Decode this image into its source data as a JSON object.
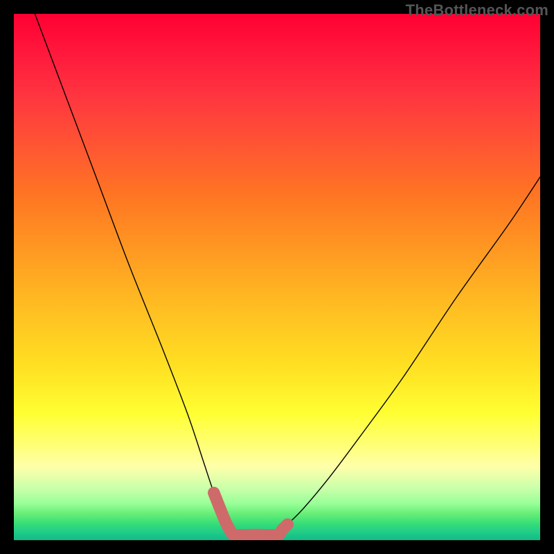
{
  "watermark": "TheBottleneck.com",
  "chart_data": {
    "type": "line",
    "title": "",
    "xlabel": "",
    "ylabel": "",
    "xlim": [
      0,
      100
    ],
    "ylim": [
      0,
      100
    ],
    "grid": false,
    "background_gradient": {
      "top_color": "#ff0033",
      "mid_color": "#ffff33",
      "bottom_color": "#22cc88",
      "description": "vertical red→yellow→green gradient; bottom ~3% shows striped green bands"
    },
    "series": [
      {
        "name": "bottleneck-curve",
        "description": "black V-shaped curve; steep descent on left, shallower ascent on right",
        "color": "#000000",
        "x": [
          4,
          10,
          16,
          22,
          28,
          33,
          36,
          38,
          40,
          41,
          42,
          46,
          50,
          51,
          52,
          55,
          60,
          66,
          74,
          84,
          94,
          100
        ],
        "y": [
          100,
          84,
          68,
          52,
          37,
          24,
          15,
          9,
          4,
          2,
          1,
          1,
          1,
          2,
          3,
          6,
          12,
          20,
          31,
          46,
          60,
          69
        ]
      },
      {
        "name": "valley-highlight",
        "description": "short thick salmon segment tracing the bottom of the V",
        "color": "#cf6a6a",
        "x": [
          38,
          40,
          41,
          42,
          46,
          50,
          51,
          52
        ],
        "y": [
          9,
          4,
          2,
          1,
          1,
          1,
          2,
          3
        ]
      }
    ]
  }
}
